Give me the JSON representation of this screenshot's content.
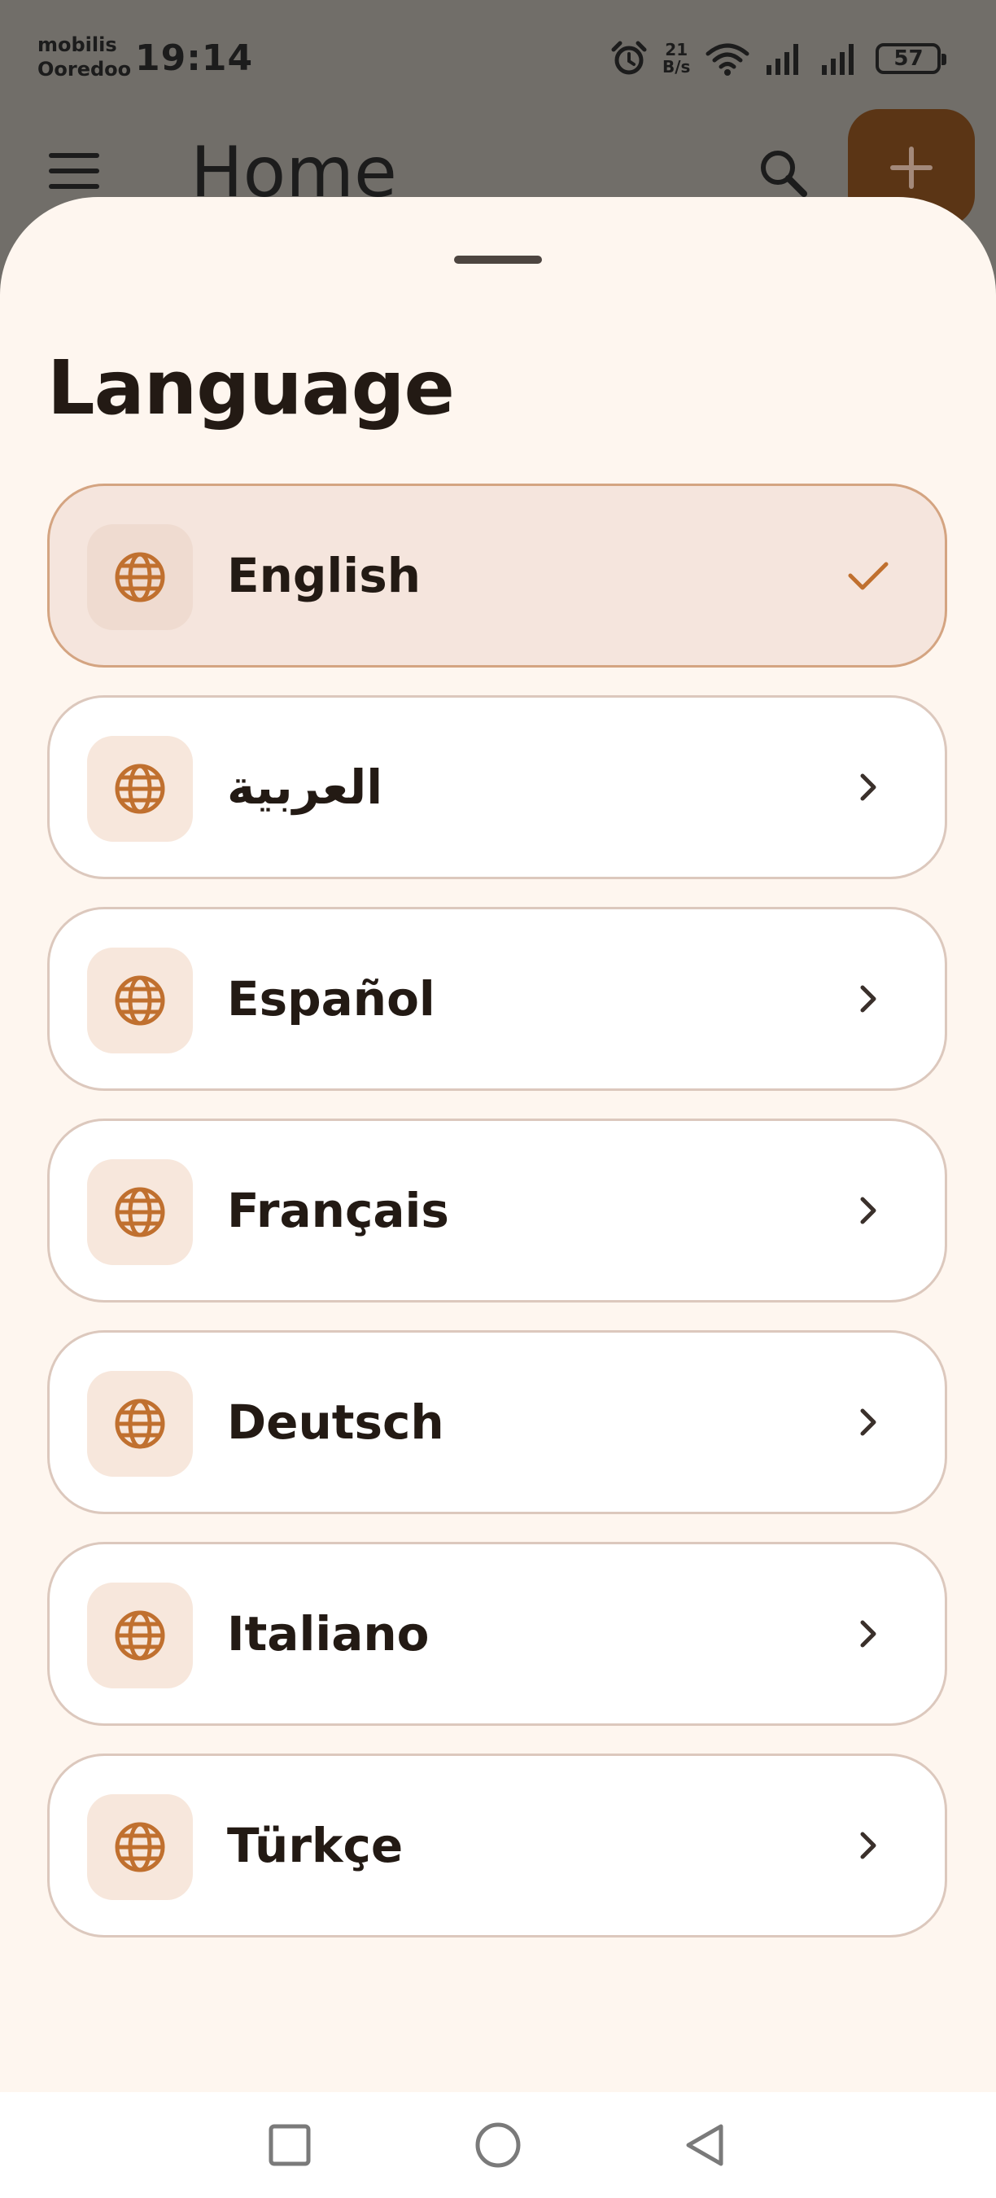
{
  "status_bar": {
    "carrier_line1": "mobilis",
    "carrier_line2": "Ooredoo",
    "time": "19:14",
    "net_speed_value": "21",
    "net_speed_unit": "B/s",
    "battery_level": "57",
    "icons": [
      "alarm-icon",
      "wifi-icon",
      "signal-icon",
      "signal-icon"
    ]
  },
  "app_bar": {
    "title": "Home",
    "icons": [
      "menu-icon",
      "search-icon",
      "add-icon"
    ]
  },
  "sheet": {
    "title": "Language",
    "items": [
      {
        "label": "English",
        "selected": true,
        "trailing_icon": "check-icon"
      },
      {
        "label": "العربية",
        "selected": false,
        "trailing_icon": "chevron-right-icon"
      },
      {
        "label": "Español",
        "selected": false,
        "trailing_icon": "chevron-right-icon"
      },
      {
        "label": "Français",
        "selected": false,
        "trailing_icon": "chevron-right-icon"
      },
      {
        "label": "Deutsch",
        "selected": false,
        "trailing_icon": "chevron-right-icon"
      },
      {
        "label": "Italiano",
        "selected": false,
        "trailing_icon": "chevron-right-icon"
      },
      {
        "label": "Türkçe",
        "selected": false,
        "trailing_icon": "chevron-right-icon"
      }
    ]
  },
  "nav_bar": {
    "icons": [
      "recents-square-icon",
      "home-circle-icon",
      "back-triangle-icon"
    ]
  },
  "colors": {
    "accent": "#c0702f",
    "selected_bg": "#f5e5dd",
    "sheet_bg": "#fef6ef",
    "scrim": "#716e69",
    "fab": "#5b3515"
  }
}
